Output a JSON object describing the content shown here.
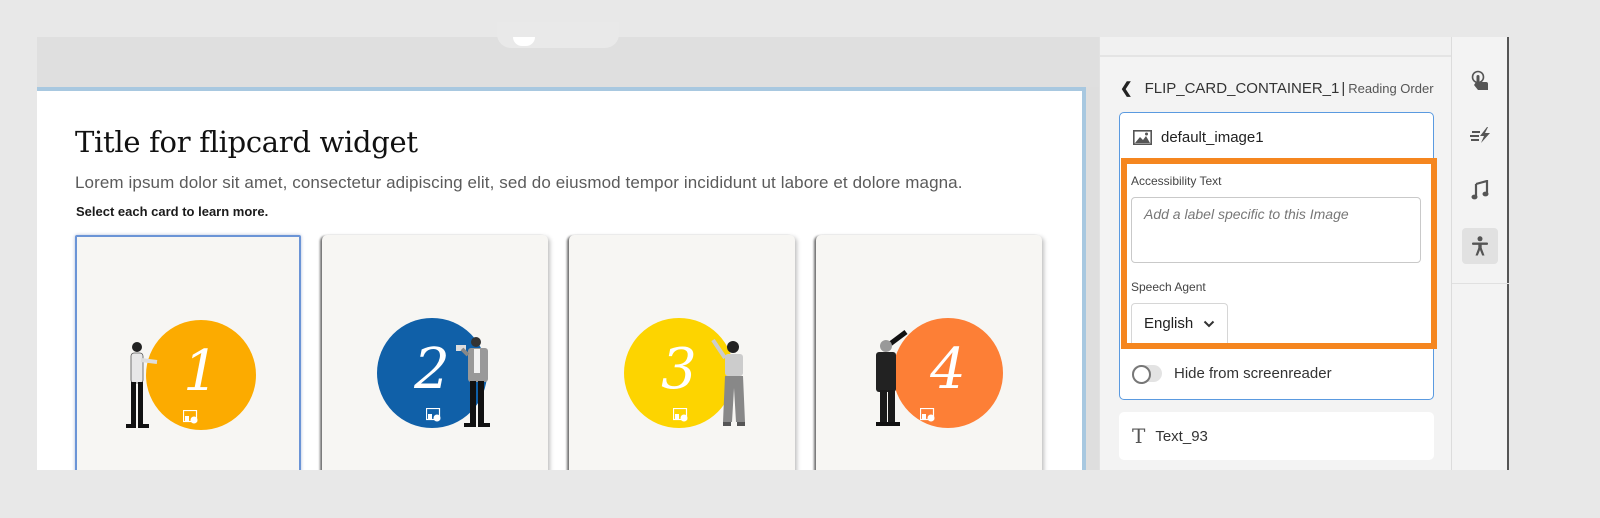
{
  "canvas": {
    "title": "Title for flipcard widget",
    "description": "Lorem ipsum dolor sit amet, consectetur adipiscing elit, sed do eiusmod tempor incididunt ut labore et dolore magna.",
    "instruction": "Select each card to learn more.",
    "cards": [
      {
        "number": "1",
        "color": "#fcab00",
        "selected": true
      },
      {
        "number": "2",
        "color": "#1060a8",
        "selected": false
      },
      {
        "number": "3",
        "color": "#fdd400",
        "selected": false
      },
      {
        "number": "4",
        "color": "#fd7f36",
        "selected": false
      }
    ]
  },
  "panel": {
    "container_name": "FLIP_CARD_CONTAINER_1",
    "separator": "|",
    "section": "Reading Order",
    "selected_item": {
      "icon": "image-icon",
      "name": "default_image1",
      "accessibility_label": "Accessibility Text",
      "accessibility_placeholder": "Add a label specific to this Image",
      "accessibility_value": "",
      "speech_agent_label": "Speech Agent",
      "speech_agent_value": "English",
      "hide_label": "Hide from screenreader",
      "hide_enabled": false
    },
    "next_item": {
      "icon": "text-icon",
      "glyph": "T",
      "name": "Text_93"
    },
    "highlight_color": "#f5861f"
  },
  "rail": {
    "items": [
      {
        "name": "interaction",
        "icon": "touch-icon",
        "active": false
      },
      {
        "name": "animation",
        "icon": "effects-icon",
        "active": false
      },
      {
        "name": "audio",
        "icon": "music-icon",
        "active": false
      },
      {
        "name": "accessibility",
        "icon": "accessibility-icon",
        "active": true
      }
    ]
  }
}
